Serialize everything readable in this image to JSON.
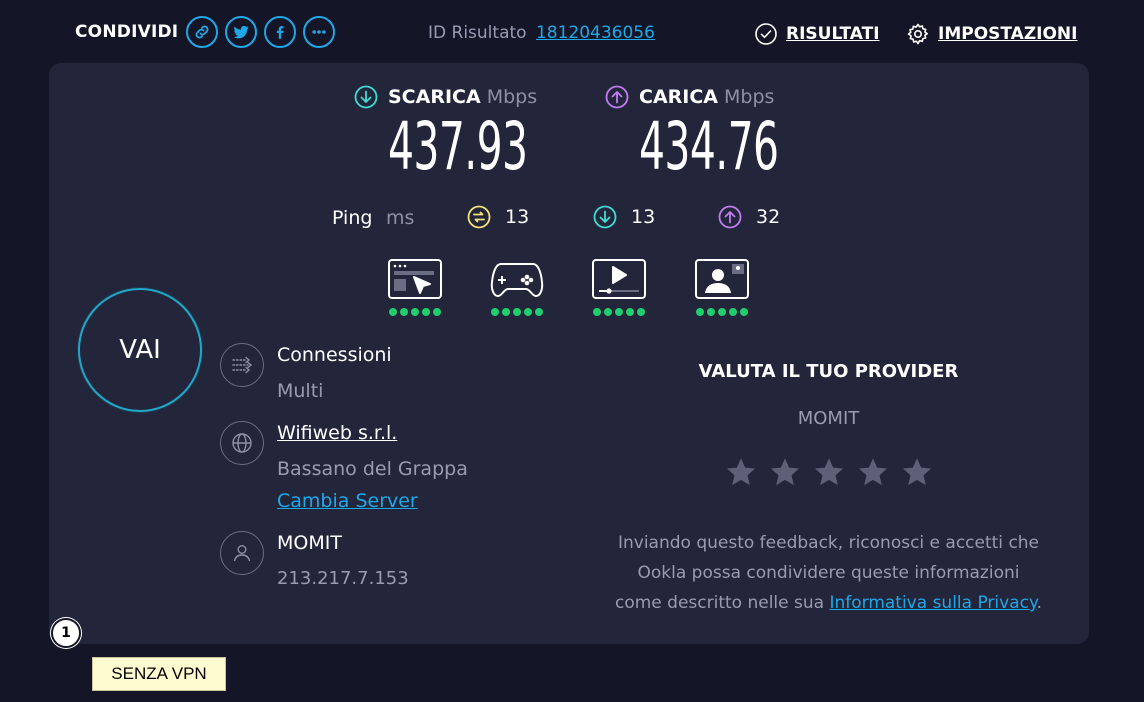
{
  "header": {
    "share_label": "CONDIVIDI",
    "share_buttons": [
      "link-icon",
      "twitter-icon",
      "facebook-icon",
      "more-icon"
    ],
    "result_id_label": "ID Risultato",
    "result_id_value": "18120436056",
    "results_label": "RISULTATI",
    "settings_label": "IMPOSTAZIONI"
  },
  "speeds": {
    "download_label": "SCARICA",
    "download_unit": "Mbps",
    "download_value": "437.93",
    "upload_label": "CARICA",
    "upload_unit": "Mbps",
    "upload_value": "434.76"
  },
  "ping": {
    "label": "Ping",
    "unit": "ms",
    "idle": "13",
    "download": "13",
    "upload": "32"
  },
  "quality_icons": [
    {
      "name": "web-browsing-icon",
      "rating": 5
    },
    {
      "name": "gaming-icon",
      "rating": 5
    },
    {
      "name": "video-streaming-icon",
      "rating": 5
    },
    {
      "name": "video-chat-icon",
      "rating": 5
    }
  ],
  "go_button": "VAI",
  "connections": {
    "title": "Connessioni",
    "value": "Multi"
  },
  "server": {
    "name": "Wifiweb s.r.l.",
    "location": "Bassano del Grappa",
    "change_label": "Cambia Server"
  },
  "provider": {
    "name": "MOMIT",
    "ip": "213.217.7.153"
  },
  "rating": {
    "title": "VALUTA IL TUO PROVIDER",
    "provider": "MOMIT",
    "star_count": 5,
    "disclaimer_line1": "Inviando questo feedback, riconosci e accetti che",
    "disclaimer_line2": "Ookla possa condividere queste informazioni",
    "disclaimer_line3_prefix": "come descritto nelle sua ",
    "privacy_link": "Informativa sulla Privacy",
    "disclaimer_suffix": "."
  },
  "annotation": {
    "badge": "1",
    "tooltip": "SENZA VPN"
  },
  "colors": {
    "background": "#141526",
    "card": "#23253a",
    "accent_blue": "#1fa8e8",
    "download_cyan": "#3fdcd2",
    "upload_purple": "#c27cf2",
    "ping_yellow": "#f5e47a",
    "dots_green": "#1fcf6e"
  }
}
